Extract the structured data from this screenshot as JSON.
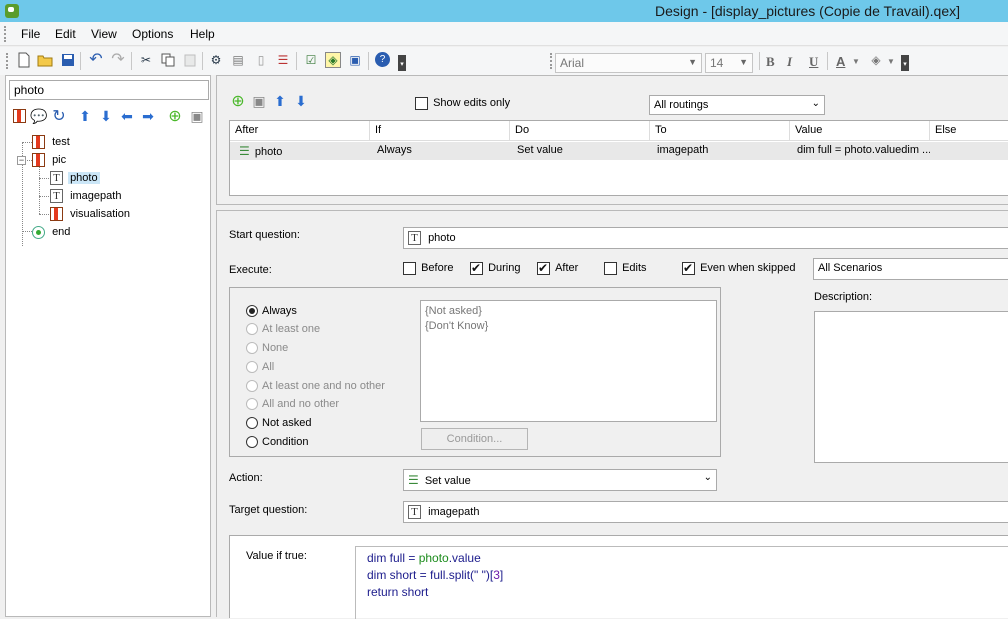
{
  "window": {
    "title": "Design - [display_pictures (Copie de Travail).qex]"
  },
  "menu": [
    "File",
    "Edit",
    "View",
    "Options",
    "Help"
  ],
  "toolbar": {
    "font": "Arial",
    "size": "14",
    "bold": "B",
    "italic": "I",
    "underline": "U",
    "text_color": "A"
  },
  "left": {
    "search_value": "photo",
    "tree": [
      {
        "label": "test",
        "icon": "book-icon"
      },
      {
        "label": "pic",
        "icon": "book-icon"
      },
      {
        "label": "photo",
        "icon": "text-question-icon",
        "selected": true
      },
      {
        "label": "imagepath",
        "icon": "text-question-icon"
      },
      {
        "label": "visualisation",
        "icon": "book-icon"
      },
      {
        "label": "end",
        "icon": "end-icon"
      }
    ]
  },
  "routing": {
    "show_edits_label": "Show edits only",
    "routings_select": "All routings",
    "columns": [
      "After",
      "If",
      "Do",
      "To",
      "Value",
      "Else"
    ],
    "rows": [
      {
        "after": "photo",
        "if": "Always",
        "do": "Set value",
        "to": "imagepath",
        "value": "dim full = photo.valuedim ...",
        "else": ""
      }
    ]
  },
  "detail": {
    "start_question_label": "Start question:",
    "start_question_value": "photo",
    "execute_label": "Execute:",
    "execute_options": [
      {
        "label": "Before",
        "checked": false
      },
      {
        "label": "During",
        "checked": true
      },
      {
        "label": "After",
        "checked": true
      },
      {
        "label": "Edits",
        "checked": false
      },
      {
        "label": "Even when skipped",
        "checked": true
      }
    ],
    "scenarios_value": "All Scenarios",
    "description_label": "Description:",
    "conditions": [
      {
        "label": "Always",
        "selected": true,
        "enabled": true
      },
      {
        "label": "At least one",
        "selected": false,
        "enabled": false
      },
      {
        "label": "None",
        "selected": false,
        "enabled": false
      },
      {
        "label": "All",
        "selected": false,
        "enabled": false
      },
      {
        "label": "At least one and no other",
        "selected": false,
        "enabled": false
      },
      {
        "label": "All and no other",
        "selected": false,
        "enabled": false
      },
      {
        "label": "Not asked",
        "selected": false,
        "enabled": true
      },
      {
        "label": "Condition",
        "selected": false,
        "enabled": true
      }
    ],
    "skip_items": [
      "{Not asked}",
      "{Don't Know}"
    ],
    "condition_button": "Condition...",
    "action_label": "Action:",
    "action_value": "Set value",
    "target_label": "Target question:",
    "target_value": "imagepath",
    "value_label": "Value if true:",
    "code_lines": [
      [
        "dim full = ",
        "photo",
        ".value"
      ],
      [
        "dim short = full.split(\" \")[",
        "3",
        "]"
      ],
      [
        "return short"
      ]
    ]
  }
}
